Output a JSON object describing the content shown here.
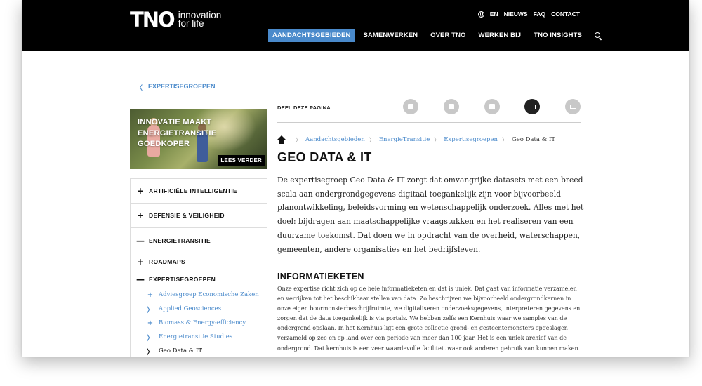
{
  "header": {
    "logo_mark": "TNO",
    "logo_tagline_1": "innovation",
    "logo_tagline_2": "for life",
    "util": [
      "EN",
      "NIEUWS",
      "FAQ",
      "CONTACT"
    ],
    "nav": [
      "AANDACHTSGEBIEDEN",
      "SAMENWERKEN",
      "OVER TNO",
      "WERKEN BIJ",
      "TNO INSIGHTS"
    ],
    "active_nav": "AANDACHTSGEBIEDEN",
    "accent": "#4a8acb"
  },
  "back_link": {
    "arrow": "〈",
    "label": "EXPERTISEGROEPEN"
  },
  "promo": {
    "title": "INNOVATIE MAAKT ENERGIETRANSITIE GOEDKOPER",
    "button": "LEES VERDER"
  },
  "sidebar": {
    "top_items": [
      {
        "symbol": "+",
        "label": "ARTIFICIËLE INTELLIGENTIE"
      },
      {
        "symbol": "+",
        "label": "DEFENSIE & VEILIGHEID"
      }
    ],
    "open_item": {
      "symbol": "—",
      "label": "ENERGIETRANSITIE"
    },
    "sub_items": [
      {
        "symbol": "+",
        "label": "ROADMAPS"
      },
      {
        "symbol": "—",
        "label": "EXPERTISEGROEPEN"
      }
    ],
    "leaves": [
      {
        "symbol": "+",
        "label": "Adviesgroep Economische Zaken"
      },
      {
        "symbol": "〉",
        "label": "Applied Geosciences"
      },
      {
        "symbol": "+",
        "label": "Biomass & Energy-efficiency"
      },
      {
        "symbol": "〉",
        "label": "Energietransitie Studies"
      },
      {
        "symbol": "〉",
        "label": "Geo Data & IT"
      }
    ]
  },
  "share": {
    "label": "DEEL DEZE PAGINA",
    "buttons": [
      "facebook-icon",
      "twitter-icon",
      "linkedin-icon",
      "email-icon",
      "print-icon"
    ]
  },
  "breadcrumb": {
    "links": [
      "Aandachtsgebieden",
      "EnergieTransitie",
      "Expertisegroepen"
    ],
    "current": "Geo Data & IT",
    "separator": "〉"
  },
  "main": {
    "title": "GEO DATA & IT",
    "intro": "De expertisegroep Geo Data & IT zorgt dat omvangrijke datasets met een breed scala aan ondergrondgegevens digitaal toegankelijk zijn voor bijvoorbeeld planontwikkeling, beleidsvorming en wetenschappelijk onderzoek. Alles met het doel: bijdragen aan maatschappelijke vraagstukken en het realiseren van een duurzame toekomst. Dat doen we in opdracht van de overheid, waterschappen, gemeenten, andere organisaties en het bedrijfsleven.",
    "section_title": "INFORMATIEKETEN",
    "section_body": "Onze expertise richt zich op de hele informatieketen en dat is uniek. Dat gaat van informatie verzamelen en verrijken tot het beschikbaar stellen van data. Zo beschrijven we bijvoorbeeld ondergrondkernen in onze eigen boormonsterbeschrijfruimte, we digitaliseren onderzoeksgegevens, interpreteren gegevens en zorgen dat de data toegankelijk is via portals. We hebben zelfs een Kernhuis waar we samples van de ondergrond opslaan. In het Kernhuis ligt een grote collectie grond- en gesteentemonsters opgeslagen verzameld op zee en op land over een periode van meer dan 100 jaar. Het is een uniek archief van de ondergrond. Dat kernhuis is een zeer waardevolle faciliteit waar ook anderen gebruik van kunnen maken."
  }
}
